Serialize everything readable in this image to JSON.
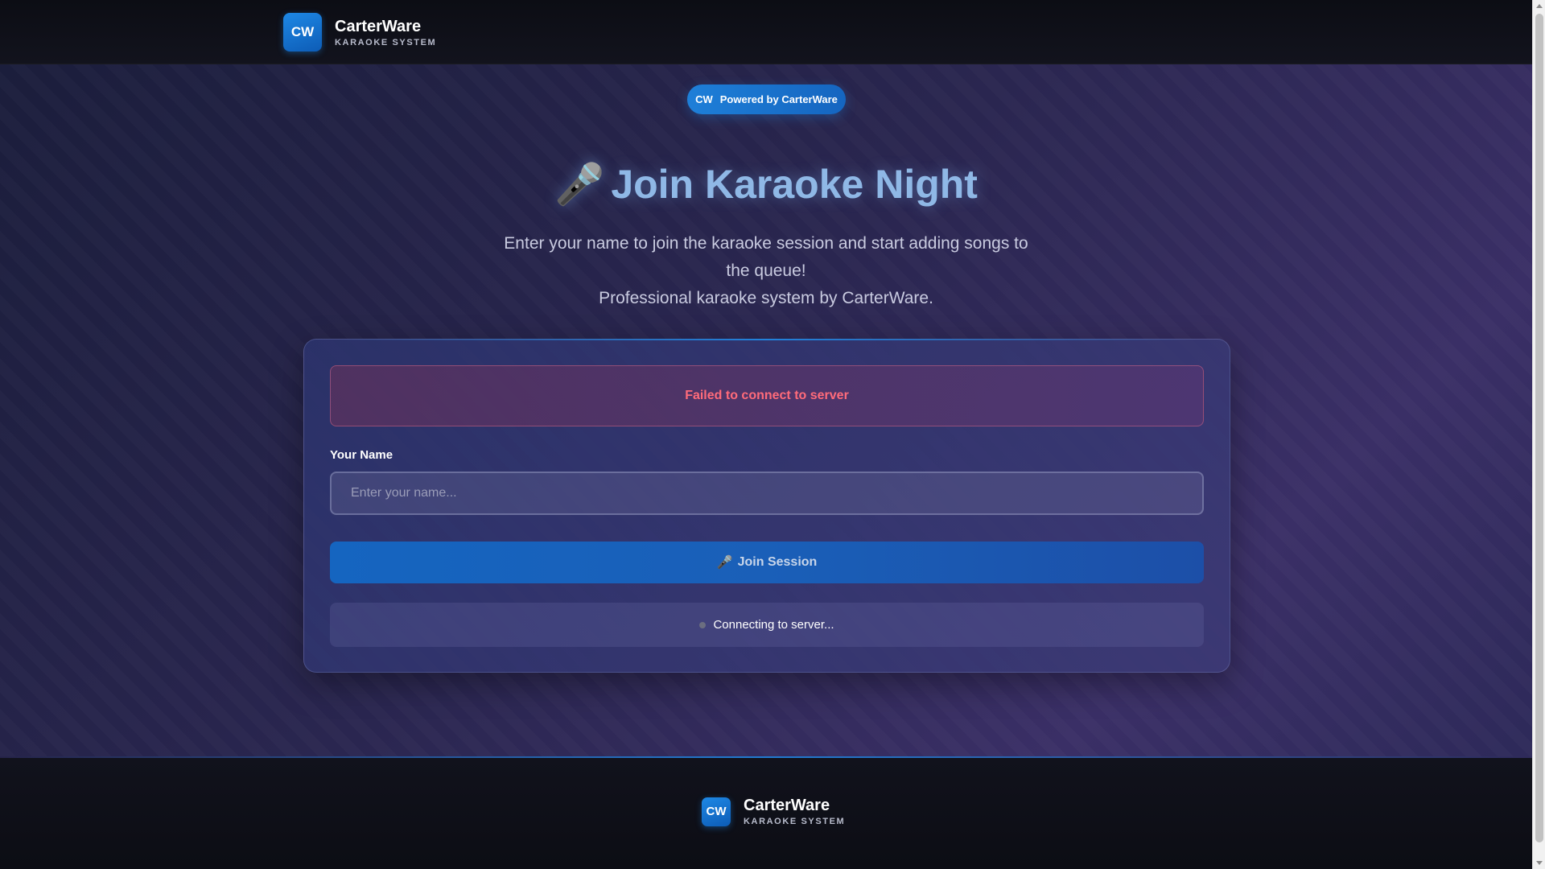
{
  "header": {
    "logo": "CW",
    "brand_name": "CarterWare",
    "brand_sub": "KARAOKE SYSTEM"
  },
  "powered": {
    "logo": "CW",
    "label": "Powered by CarterWare"
  },
  "main": {
    "title_icon": "🎤",
    "title": "Join Karaoke Night",
    "subtitle_line1": "Enter your name to join the karaoke session and start adding songs to the queue!",
    "subtitle_line2": "Professional karaoke system by CarterWare."
  },
  "card": {
    "error": "Failed to connect to server",
    "name_label": "Your Name",
    "name_value": "",
    "name_placeholder": "Enter your name...",
    "join_icon": "🎤",
    "join_label": "Join Session",
    "status": "Connecting to server..."
  },
  "footer": {
    "logo": "CW",
    "brand_name": "CarterWare",
    "brand_sub": "KARAOKE SYSTEM"
  },
  "icons": {
    "title": "microphone-icon",
    "button": "microphone-icon",
    "status": "status-dot-icon"
  },
  "colors": {
    "accent": "#1e88e5",
    "error": "#ff6b7a",
    "title": "#8fb8e6"
  }
}
